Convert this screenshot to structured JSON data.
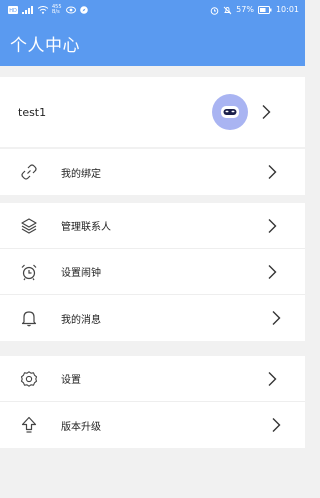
{
  "status_bar": {
    "speed_value": "455",
    "speed_unit": "B/s",
    "battery": "57%",
    "time": "10:01"
  },
  "header": {
    "title": "个人中心"
  },
  "profile": {
    "username": "test1"
  },
  "menu_group_1": [
    {
      "label": "我的绑定",
      "icon": "link-icon"
    }
  ],
  "menu_group_2": [
    {
      "label": "管理联系人",
      "icon": "layers-icon"
    },
    {
      "label": "设置闹钟",
      "icon": "alarm-clock-icon"
    },
    {
      "label": "我的消息",
      "icon": "bell-icon"
    }
  ],
  "menu_group_3": [
    {
      "label": "设置",
      "icon": "gear-icon"
    },
    {
      "label": "版本升级",
      "icon": "upgrade-arrow-icon"
    }
  ],
  "colors": {
    "header_bg": "#5a9af0",
    "avatar_bg": "#a9b4f2",
    "page_bg": "#f1f1f1"
  }
}
